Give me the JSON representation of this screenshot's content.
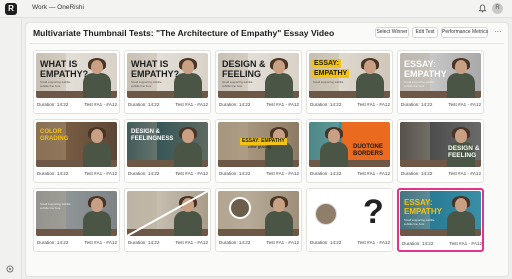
{
  "app": {
    "logo_text": "R",
    "breadcrumb": "Work — OneRishi",
    "avatar_text": "R"
  },
  "header": {
    "title": "Multivariate Thumbnail Tests: \"The Architecture of Empathy\" Essay Video",
    "select_winner": "Select Winner",
    "edit_test": "Edit Test",
    "performance_metrics": "Performance Metrics",
    "more": "···"
  },
  "colors": {
    "accent_selected": "#e2348f",
    "yellow": "#f2c316"
  },
  "thumbnails": [
    {
      "duration": "Duration: 14:22",
      "test": "Test #A1 - #A12",
      "headline": [
        "WHAT IS",
        "EMPATHY?"
      ],
      "sub": [
        "Small supporting subtitle",
        "subtitle line here"
      ],
      "style": "light"
    },
    {
      "duration": "Duration: 14:22",
      "test": "Test #A1 - #A12",
      "headline": [
        "WHAT IS",
        "EMPATHY?"
      ],
      "sub": [
        "Small supporting subtitle",
        "subtitle line here"
      ],
      "style": "light"
    },
    {
      "duration": "Duration: 14:22",
      "test": "Test #A1 - #A12",
      "headline": [
        "DESIGN &",
        "FEELING"
      ],
      "sub": [
        "Small supporting subtitle",
        "subtitle line here"
      ],
      "style": "light"
    },
    {
      "duration": "Duration: 14:22",
      "test": "Test #A1 - #A12",
      "headline": [
        "ESSAY:",
        "EMPATHY"
      ],
      "sub": [
        "Small supporting subtitle"
      ],
      "style": "yellow"
    },
    {
      "duration": "Duration: 14:22",
      "test": "Test #A1 - #A12",
      "headline": [
        "ESSAY:",
        "EMPATHY"
      ],
      "sub": [
        "Small supporting subtitle",
        "subtitle line here"
      ],
      "style": "grey"
    },
    {
      "duration": "Duration: 14:22",
      "test": "Test #A1 - #A12",
      "headline": [
        "COLOR",
        "GRADING"
      ],
      "sub": [],
      "style": "warm"
    },
    {
      "duration": "Duration: 14:22",
      "test": "Test #A1 - #A12",
      "headline": [
        "DESIGN &",
        "FEELINGNESS"
      ],
      "sub": [],
      "style": "teal"
    },
    {
      "duration": "Duration: 14:22",
      "test": "Test #A1 - #A12",
      "headline": [
        "ESSAY: EMPATHY",
        "color grading"
      ],
      "sub": [],
      "style": "centerband"
    },
    {
      "duration": "Duration: 14:22",
      "test": "Test #A1 - #A12",
      "headline": [
        "DUOTONE",
        "BORDERS"
      ],
      "sub": [],
      "style": "orange"
    },
    {
      "duration": "Duration: 14:22",
      "test": "Test #A1 - #A12",
      "headline": [
        "DESIGN &",
        "FEELING"
      ],
      "sub": [],
      "style": "dark"
    },
    {
      "duration": "Duration: 14:22",
      "test": "Test #A1 - #A12",
      "headline": [],
      "sub": [
        "Small supporting subtitle",
        "subtitle line here"
      ],
      "style": "muted"
    },
    {
      "duration": "Duration: 14:22",
      "test": "Test #A1 - #A12",
      "headline": [],
      "sub": [],
      "style": "diagonal"
    },
    {
      "duration": "Duration: 14:22",
      "test": "Test #A1 - #A12",
      "headline": [],
      "sub": [],
      "style": "circle"
    },
    {
      "duration": "Duration: 14:22",
      "test": "Test #A1 - #A12",
      "headline": [
        "?"
      ],
      "sub": [],
      "style": "question"
    },
    {
      "duration": "Duration: 14:22",
      "test": "Test #A1 - #A12",
      "headline": [
        "ESSAY:",
        "EMPATHY"
      ],
      "sub": [
        "Small supporting subtitle",
        "subtitle line here"
      ],
      "style": "selected",
      "selected": true
    }
  ]
}
